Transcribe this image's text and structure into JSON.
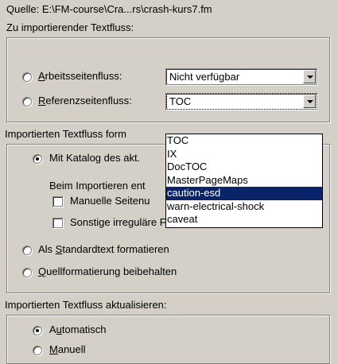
{
  "source": {
    "label": "Quelle:",
    "path": "E:\\FM-course\\Cra...rs\\crash-kurs7.fm"
  },
  "import_flow": {
    "title": "Zu importierender Textfluss:",
    "option_body": {
      "accel": "A",
      "rest": "rbeitsseitenfluss:",
      "combo_value": "Nicht verfügbar"
    },
    "option_ref": {
      "accel": "R",
      "rest": "eferenzseitenfluss:",
      "combo_value": "TOC"
    }
  },
  "dropdown": {
    "items": [
      "TOC",
      "IX",
      "DocTOC",
      "MasterPageMaps",
      "caution-esd",
      "warn-electrical-shock",
      "caveat"
    ],
    "selected": "caution-esd"
  },
  "format_group": {
    "title": "Importierten Textfluss form",
    "catalog_option": "Mit Katalog des akt.",
    "on_import_label": "Beim Importieren ent",
    "check_manual": "Manuelle Seitenu",
    "check_other": "Sonstige irreguläre Formatzuweisungen",
    "option_standard": {
      "accel": "S",
      "before": "Als ",
      "rest": "tandardtext formatieren"
    },
    "option_source": {
      "accel": "Q",
      "rest": "uellformatierung beibehalten"
    }
  },
  "update_group": {
    "title": "Importierten Textfluss aktualisieren:",
    "option_auto": {
      "before": "A",
      "accel": "u",
      "rest": "tomatisch"
    },
    "option_manual": {
      "accel": "M",
      "rest": "anuell"
    }
  }
}
